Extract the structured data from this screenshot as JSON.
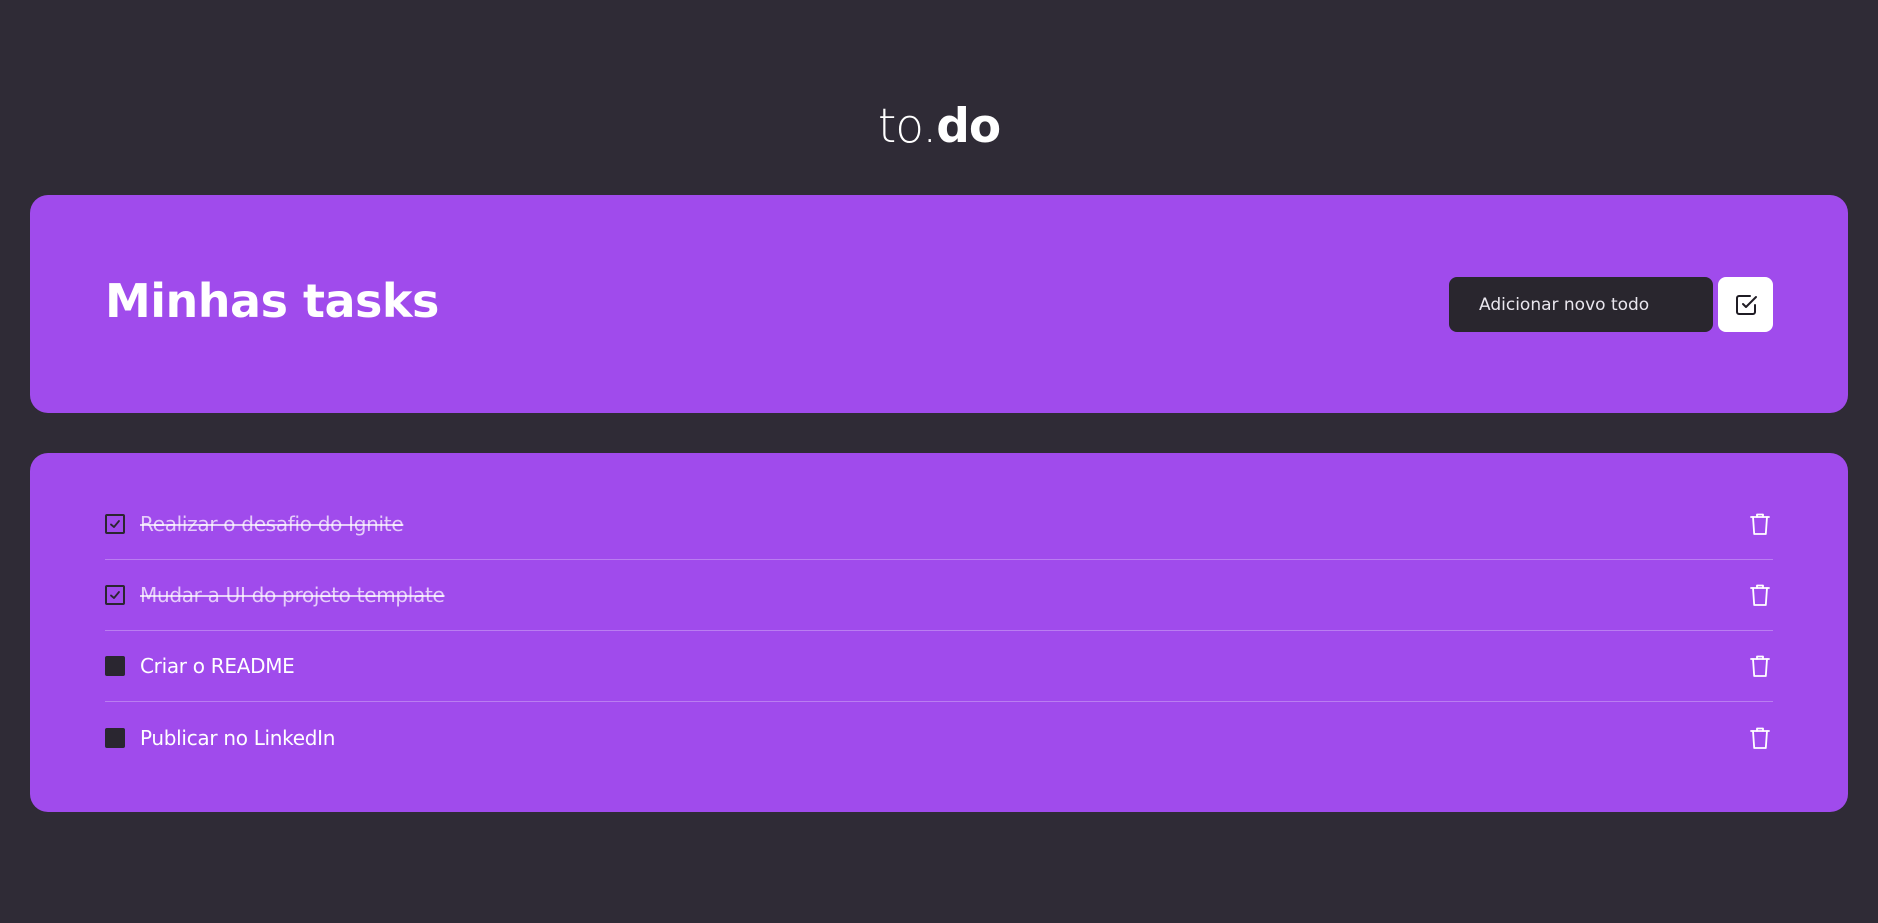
{
  "logo": {
    "light": "to.",
    "bold": "do"
  },
  "header": {
    "title": "Minhas tasks",
    "input_placeholder": "Adicionar novo todo",
    "add_icon": "checkbox-check-icon"
  },
  "tasks": [
    {
      "text": "Realizar o desafio do Ignite",
      "completed": true
    },
    {
      "text": "Mudar a UI do projeto template",
      "completed": true
    },
    {
      "text": "Criar o README",
      "completed": false
    },
    {
      "text": "Publicar no LinkedIn",
      "completed": false
    }
  ],
  "icons": {
    "checked": "checkbox-checked-icon",
    "unchecked": "checkbox-unchecked-icon",
    "delete": "trash-icon"
  },
  "colors": {
    "background": "#2f2b36",
    "card": "#a04bec",
    "input": "#29262e",
    "text": "#ffffff"
  }
}
